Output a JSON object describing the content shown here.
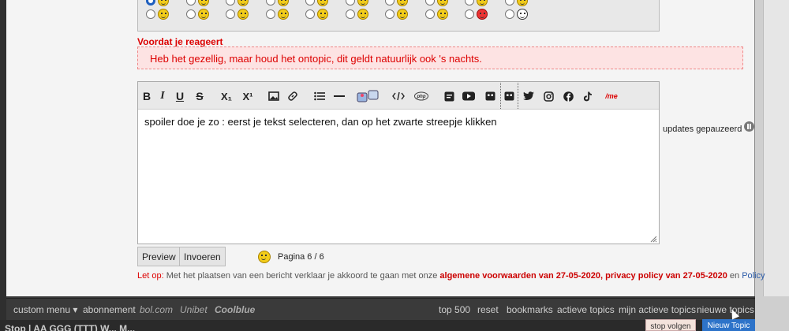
{
  "warning": {
    "title": "Voordat je reageert",
    "message": "Heb het gezellig, maar houd het ontopic, dit geldt natuurlijk ook 's nachts."
  },
  "editor": {
    "text": "spoiler doe je zo : eerst je tekst selecteren, dan op het zwarte streepje klikken",
    "toolbar": {
      "bold": "B",
      "italic": "I",
      "underline": "U",
      "strike": "S",
      "subscript": "X₁",
      "superscript": "X¹",
      "me": "/me"
    }
  },
  "status": {
    "paused_label": "updates gepauzeerd"
  },
  "buttons": {
    "preview": "Preview",
    "submit": "Invoeren"
  },
  "pagination": {
    "label": "Pagina 6 / 6"
  },
  "notice": {
    "prefix": "Let op:",
    "text": " Met het plaatsen van een bericht verklaar je akkoord te gaan met onze ",
    "terms": "algemene voorwaarden van 27-05-2020",
    "sep": ", ",
    "privacy": "privacy policy van 27-05-2020",
    "and": " en ",
    "policy": "Policy"
  },
  "footer": {
    "custom_menu": "custom menu ▾",
    "abonnement": "abonnement",
    "bol": "bol.com",
    "unibet": "Unibet",
    "coolblue": "Coolblue",
    "top500": "top 500",
    "reset": "reset",
    "bookmarks": "bookmarks",
    "actieve": "actieve topics",
    "mijn_actieve": "mijn actieve topics",
    "nieuwe": "nieuwe topics"
  },
  "bottom": {
    "crumb": "Stop | AA GGG (TTT) W... M...",
    "follow": "stop volgen",
    "new_topic": "Nieuw Topic"
  },
  "colors": {
    "accent_red": "#dd0000",
    "accent_blue": "#2d73c9",
    "warn_bg": "#fde3e3"
  }
}
